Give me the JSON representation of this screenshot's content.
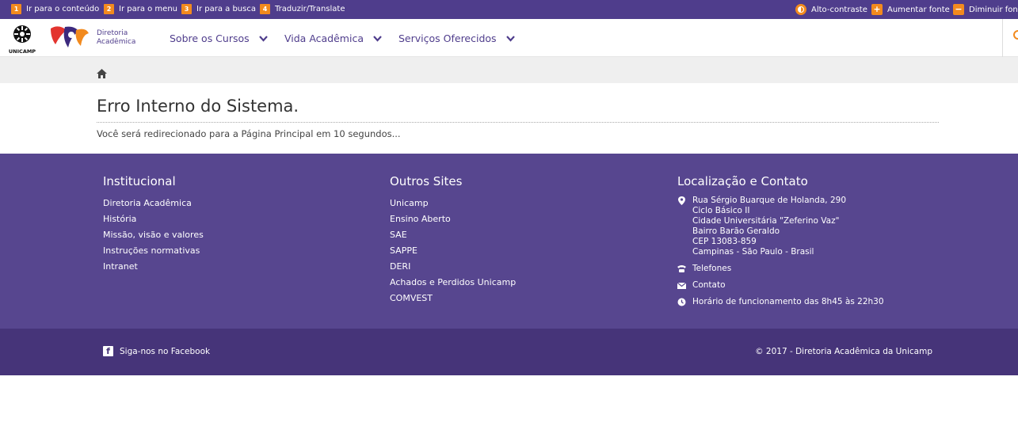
{
  "a11y": {
    "items": [
      {
        "num": "1",
        "label": "Ir para o conteúdo"
      },
      {
        "num": "2",
        "label": "Ir para o menu"
      },
      {
        "num": "3",
        "label": "Ir para a busca"
      },
      {
        "num": "4",
        "label": "Traduzir/Translate"
      }
    ],
    "contrast_label": "Alto-contraste",
    "increase_label": "Aumentar fonte",
    "decrease_label": "Diminuir fonte",
    "plus_glyph": "+",
    "minus_glyph": "−"
  },
  "header": {
    "unicamp_label": "UNICAMP",
    "brand_line1": "Diretoria",
    "brand_line2": "Acadêmica",
    "nav": [
      {
        "label": "Sobre os Cursos"
      },
      {
        "label": "Vida Acadêmica"
      },
      {
        "label": "Serviços Oferecidos"
      }
    ]
  },
  "main": {
    "title": "Erro Interno do Sistema.",
    "message": "Você será redirecionado para a Página Principal em 10 segundos..."
  },
  "footer": {
    "institucional": {
      "heading": "Institucional",
      "links": [
        "Diretoria Acadêmica",
        "História",
        "Missão, visão e valores",
        "Instruções normativas",
        "Intranet"
      ]
    },
    "outros": {
      "heading": "Outros Sites",
      "links": [
        "Unicamp",
        "Ensino Aberto",
        "SAE",
        "SAPPE",
        "DERI",
        "Achados e Perdidos Unicamp",
        "COMVEST"
      ]
    },
    "contato": {
      "heading": "Localização e Contato",
      "address": [
        "Rua Sérgio Buarque de Holanda, 290",
        "Ciclo Básico II",
        "Cidade Universitária \"Zeferino Vaz\"",
        "Bairro Barão Geraldo",
        "CEP 13083-859",
        "Campinas - São Paulo - Brasil"
      ],
      "phone_label": "Telefones",
      "contact_label": "Contato",
      "hours_label": "Horário de funcionamento das 8h45 às 22h30"
    }
  },
  "subfooter": {
    "facebook_label": "Siga-nos no Facebook",
    "facebook_glyph": "f",
    "copyright": "© 2017 - Diretoria Acadêmica da Unicamp"
  },
  "colors": {
    "primary": "#4f3d8c",
    "footer": "#57468f",
    "subfooter": "#463479",
    "accent": "#f28a1e"
  }
}
